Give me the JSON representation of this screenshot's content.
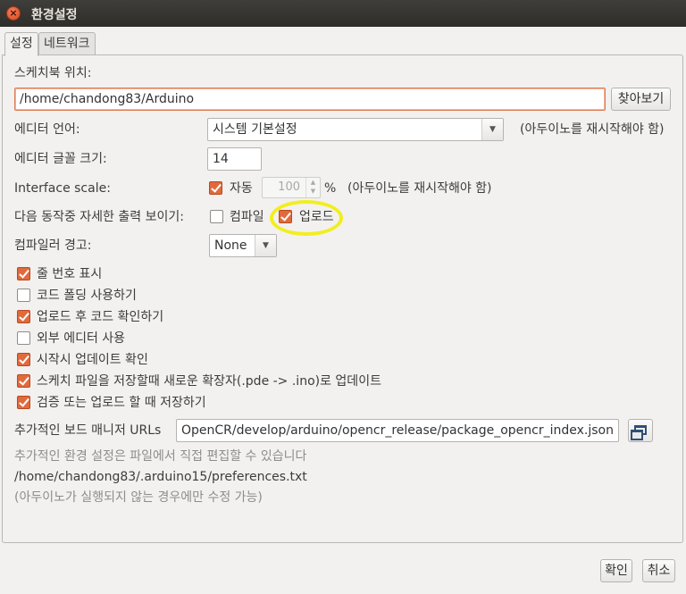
{
  "window": {
    "title": "환경설정"
  },
  "tabs": [
    {
      "label": "설정",
      "active": true
    },
    {
      "label": "네트워크",
      "active": false
    }
  ],
  "sketchbook": {
    "label": "스케치북 위치:",
    "value": "/home/chandong83/Arduino",
    "browse_label": "찾아보기"
  },
  "editor_language": {
    "label": "에디터 언어:",
    "value": "시스템 기본설정",
    "note": "(아두이노를 재시작해야 함)"
  },
  "editor_font_size": {
    "label": "에디터 글꼴 크기:",
    "value": "14"
  },
  "interface_scale": {
    "label": "Interface scale:",
    "auto_label": "자동",
    "auto_checked": true,
    "value": "100",
    "unit": "%",
    "note": "(아두이노를 재시작해야 함)"
  },
  "verbose_output": {
    "label": "다음 동작중 자세한  출력 보이기:",
    "compile_label": "컴파일",
    "compile_checked": false,
    "upload_label": "업로드",
    "upload_checked": true
  },
  "compiler_warnings": {
    "label": "컴파일러 경고:",
    "value": "None"
  },
  "options": [
    {
      "label": "줄 번호 표시",
      "checked": true
    },
    {
      "label": "코드 폴딩 사용하기",
      "checked": false
    },
    {
      "label": "업로드 후 코드 확인하기",
      "checked": true
    },
    {
      "label": "외부 에디터 사용",
      "checked": false
    },
    {
      "label": "시작시 업데이트 확인",
      "checked": true
    },
    {
      "label": "스케치 파일을 저장할때 새로운 확장자(.pde -> .ino)로 업데이트",
      "checked": true
    },
    {
      "label": "검증 또는 업로드 할 때 저장하기",
      "checked": true
    }
  ],
  "board_manager": {
    "label": "추가적인 보드 매니저 URLs",
    "value": "OpenCR/develop/arduino/opencr_release/package_opencr_index.json"
  },
  "info": {
    "line1": "추가적인 환경 설정은 파일에서 직접 편집할 수 있습니다",
    "path": "/home/chandong83/.arduino15/preferences.txt",
    "line3": "(아두이노가 실행되지 않는 경우에만 수정 가능)"
  },
  "footer": {
    "ok_label": "확인",
    "cancel_label": "취소"
  },
  "colors": {
    "accent": "#e16a3d",
    "highlight_ring": "#f2ee1f"
  }
}
